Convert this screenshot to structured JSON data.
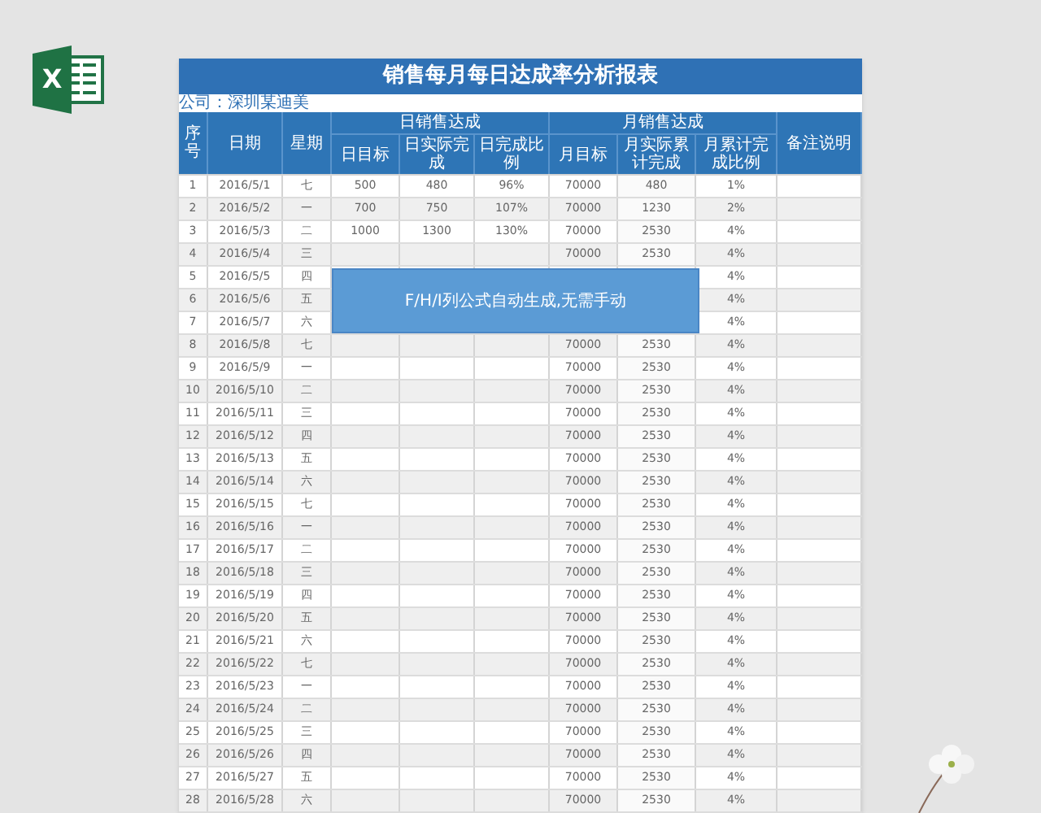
{
  "logo": {
    "letter": "X"
  },
  "sheet": {
    "title": "销售每月每日达成率分析报表",
    "company": "公司：深圳某迪美",
    "headers": {
      "number": "序号",
      "date": "日期",
      "weekday": "星期",
      "daily_group": "日销售达成",
      "daily": [
        "日目标",
        "日实际完成",
        "日完成比例"
      ],
      "monthly_group": "月销售达成",
      "monthly": [
        "月目标",
        "月实际累计完成",
        "月累计完成比例"
      ],
      "remarks": "备注说明"
    },
    "rows": [
      {
        "no": "1",
        "date": "2016/5/1",
        "weekday": "七",
        "day_target": "500",
        "day_actual": "480",
        "day_ratio": "96%",
        "month_target": "70000",
        "month_actual": "480",
        "month_ratio": "1%"
      },
      {
        "no": "2",
        "date": "2016/5/2",
        "weekday": "一",
        "day_target": "700",
        "day_actual": "750",
        "day_ratio": "107%",
        "month_target": "70000",
        "month_actual": "1230",
        "month_ratio": "2%"
      },
      {
        "no": "3",
        "date": "2016/5/3",
        "weekday": "二",
        "day_target": "1000",
        "day_actual": "1300",
        "day_ratio": "130%",
        "month_target": "70000",
        "month_actual": "2530",
        "month_ratio": "4%"
      },
      {
        "no": "4",
        "date": "2016/5/4",
        "weekday": "三",
        "month_target": "70000",
        "month_actual": "2530",
        "month_ratio": "4%"
      },
      {
        "no": "5",
        "date": "2016/5/5",
        "weekday": "四",
        "month_ratio": "4%"
      },
      {
        "no": "6",
        "date": "2016/5/6",
        "weekday": "五",
        "month_ratio": "4%"
      },
      {
        "no": "7",
        "date": "2016/5/7",
        "weekday": "六",
        "month_ratio": "4%"
      },
      {
        "no": "8",
        "date": "2016/5/8",
        "weekday": "七",
        "month_target": "70000",
        "month_actual": "2530",
        "month_ratio": "4%"
      },
      {
        "no": "9",
        "date": "2016/5/9",
        "weekday": "一",
        "month_target": "70000",
        "month_actual": "2530",
        "month_ratio": "4%"
      },
      {
        "no": "10",
        "date": "2016/5/10",
        "weekday": "二",
        "month_target": "70000",
        "month_actual": "2530",
        "month_ratio": "4%"
      },
      {
        "no": "11",
        "date": "2016/5/11",
        "weekday": "三",
        "month_target": "70000",
        "month_actual": "2530",
        "month_ratio": "4%"
      },
      {
        "no": "12",
        "date": "2016/5/12",
        "weekday": "四",
        "month_target": "70000",
        "month_actual": "2530",
        "month_ratio": "4%"
      },
      {
        "no": "13",
        "date": "2016/5/13",
        "weekday": "五",
        "month_target": "70000",
        "month_actual": "2530",
        "month_ratio": "4%"
      },
      {
        "no": "14",
        "date": "2016/5/14",
        "weekday": "六",
        "month_target": "70000",
        "month_actual": "2530",
        "month_ratio": "4%"
      },
      {
        "no": "15",
        "date": "2016/5/15",
        "weekday": "七",
        "month_target": "70000",
        "month_actual": "2530",
        "month_ratio": "4%"
      },
      {
        "no": "16",
        "date": "2016/5/16",
        "weekday": "一",
        "month_target": "70000",
        "month_actual": "2530",
        "month_ratio": "4%"
      },
      {
        "no": "17",
        "date": "2016/5/17",
        "weekday": "二",
        "month_target": "70000",
        "month_actual": "2530",
        "month_ratio": "4%"
      },
      {
        "no": "18",
        "date": "2016/5/18",
        "weekday": "三",
        "month_target": "70000",
        "month_actual": "2530",
        "month_ratio": "4%"
      },
      {
        "no": "19",
        "date": "2016/5/19",
        "weekday": "四",
        "month_target": "70000",
        "month_actual": "2530",
        "month_ratio": "4%"
      },
      {
        "no": "20",
        "date": "2016/5/20",
        "weekday": "五",
        "month_target": "70000",
        "month_actual": "2530",
        "month_ratio": "4%"
      },
      {
        "no": "21",
        "date": "2016/5/21",
        "weekday": "六",
        "month_target": "70000",
        "month_actual": "2530",
        "month_ratio": "4%"
      },
      {
        "no": "22",
        "date": "2016/5/22",
        "weekday": "七",
        "month_target": "70000",
        "month_actual": "2530",
        "month_ratio": "4%"
      },
      {
        "no": "23",
        "date": "2016/5/23",
        "weekday": "一",
        "month_target": "70000",
        "month_actual": "2530",
        "month_ratio": "4%"
      },
      {
        "no": "24",
        "date": "2016/5/24",
        "weekday": "二",
        "month_target": "70000",
        "month_actual": "2530",
        "month_ratio": "4%"
      },
      {
        "no": "25",
        "date": "2016/5/25",
        "weekday": "三",
        "month_target": "70000",
        "month_actual": "2530",
        "month_ratio": "4%"
      },
      {
        "no": "26",
        "date": "2016/5/26",
        "weekday": "四",
        "month_target": "70000",
        "month_actual": "2530",
        "month_ratio": "4%"
      },
      {
        "no": "27",
        "date": "2016/5/27",
        "weekday": "五",
        "month_target": "70000",
        "month_actual": "2530",
        "month_ratio": "4%"
      },
      {
        "no": "28",
        "date": "2016/5/28",
        "weekday": "六",
        "month_target": "70000",
        "month_actual": "2530",
        "month_ratio": "4%"
      }
    ],
    "note": "F/H/I列公式自动生成,无需手动"
  }
}
